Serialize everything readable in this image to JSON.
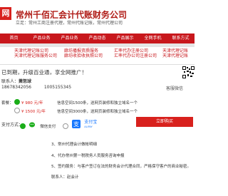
{
  "header": {
    "logo_text": "网",
    "company_name": "常州千佰汇会计代账财务公司",
    "slogan": "立足：常州工商注册代理，常州代账记账，常州代理公司"
  },
  "nav": {
    "items": [
      "首页",
      "产品业务",
      "产品业务",
      "产品动态",
      "产品展示",
      "全网手机",
      "联系方式"
    ]
  },
  "list": {
    "items": [
      {
        "line1": "天津代理记账公司",
        "line2": "天津代理记账服务公司"
      },
      {
        "line1": "廊坊播报资质服务",
        "line2": "廊坊收拾收执照公司"
      },
      {
        "line1": "汇率代办注册公司",
        "line2": "汇率代办公司注册公司"
      },
      {
        "line1": "天津代理记账",
        "line2": "天津代理记账"
      }
    ]
  },
  "popup": {
    "title": "已到期，升级百业通，享全网推广！",
    "contact_label": "联系人：",
    "contact_name": "萧怒球",
    "phone1": "18678342056",
    "phone2": "1005155345",
    "service_link": "客服微信",
    "option1_label": "套餐：",
    "option1_price": "¥ 980 元/年",
    "option1_desc": "信息空间1500条，送网页装修和独立域名一个",
    "option2_price": "¥ 1500 元/年",
    "option2_desc": "信息空间3000条，送网页装修和独立域名一个",
    "pay_label": "支付方式：",
    "pay_wechat": "微信支付",
    "pay_alipay": "支付宝",
    "pay_alipay_sub": "ALIPAY",
    "pay_button": "立即购买"
  },
  "content": {
    "lines": [
      "3、常州代理会计做帐明细",
      "4、代办常州第一税税务人员服务咨询申报",
      "5、签约服务：与客户签订在法的财务会计代理合同，严格保守客户的商业秘密。",
      "联系人：赵会计"
    ]
  }
}
